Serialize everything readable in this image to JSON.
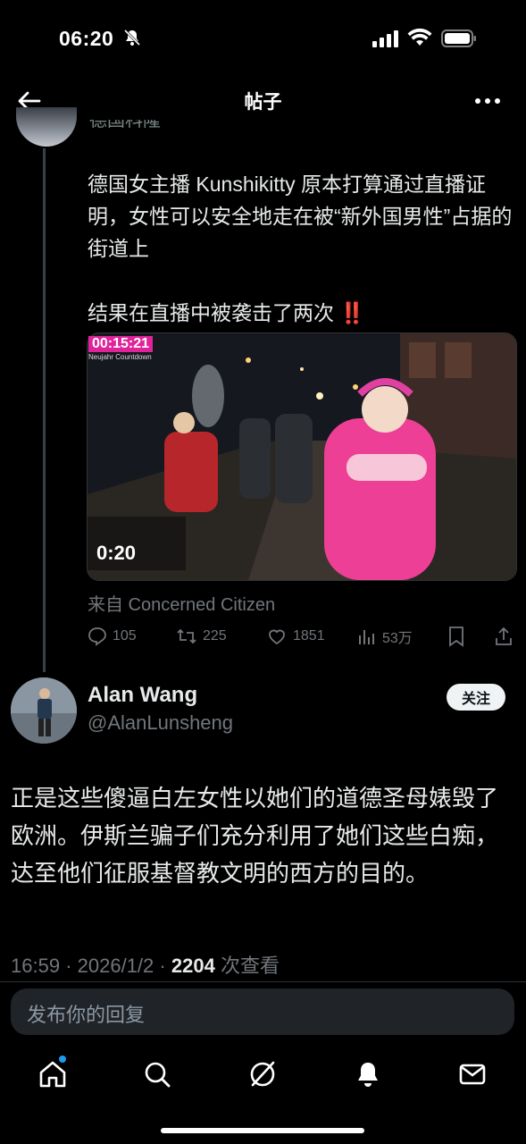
{
  "status_bar": {
    "time": "06:20"
  },
  "nav": {
    "title": "帖子"
  },
  "quoted_post": {
    "name_fragment": "德国科隆",
    "text": "德国女主播 Kunshikitty 原本打算通过直播证明，女性可以安全地走在被“新外国男性”占据的街道上\n\n结果在直播中被袭击了两次 ‼️",
    "media": {
      "timestamp": "00:15:21",
      "overlay_caption": "Neujahr Countdown",
      "duration": "0:20"
    },
    "source": "来自 Concerned Citizen",
    "actions": {
      "replies": "105",
      "reposts": "225",
      "likes": "1851",
      "views": "53万"
    }
  },
  "main_post": {
    "author_name": "Alan Wang",
    "author_handle": "@AlanLunsheng",
    "follow_label": "关注",
    "text": "正是这些傻逼白左女性以她们的道德圣母婊毁了欧洲。伊斯兰骗子们充分利用了她们这些白痴，达至他们征服基督教文明的西方的目的。",
    "time": "16:59",
    "date": "2026/1/2",
    "view_count": "2204",
    "view_label": "次查看"
  },
  "reply": {
    "placeholder": "发布你的回复"
  },
  "colors": {
    "accent": "#1d9bf0",
    "background": "#000000",
    "muted": "#71767b"
  }
}
